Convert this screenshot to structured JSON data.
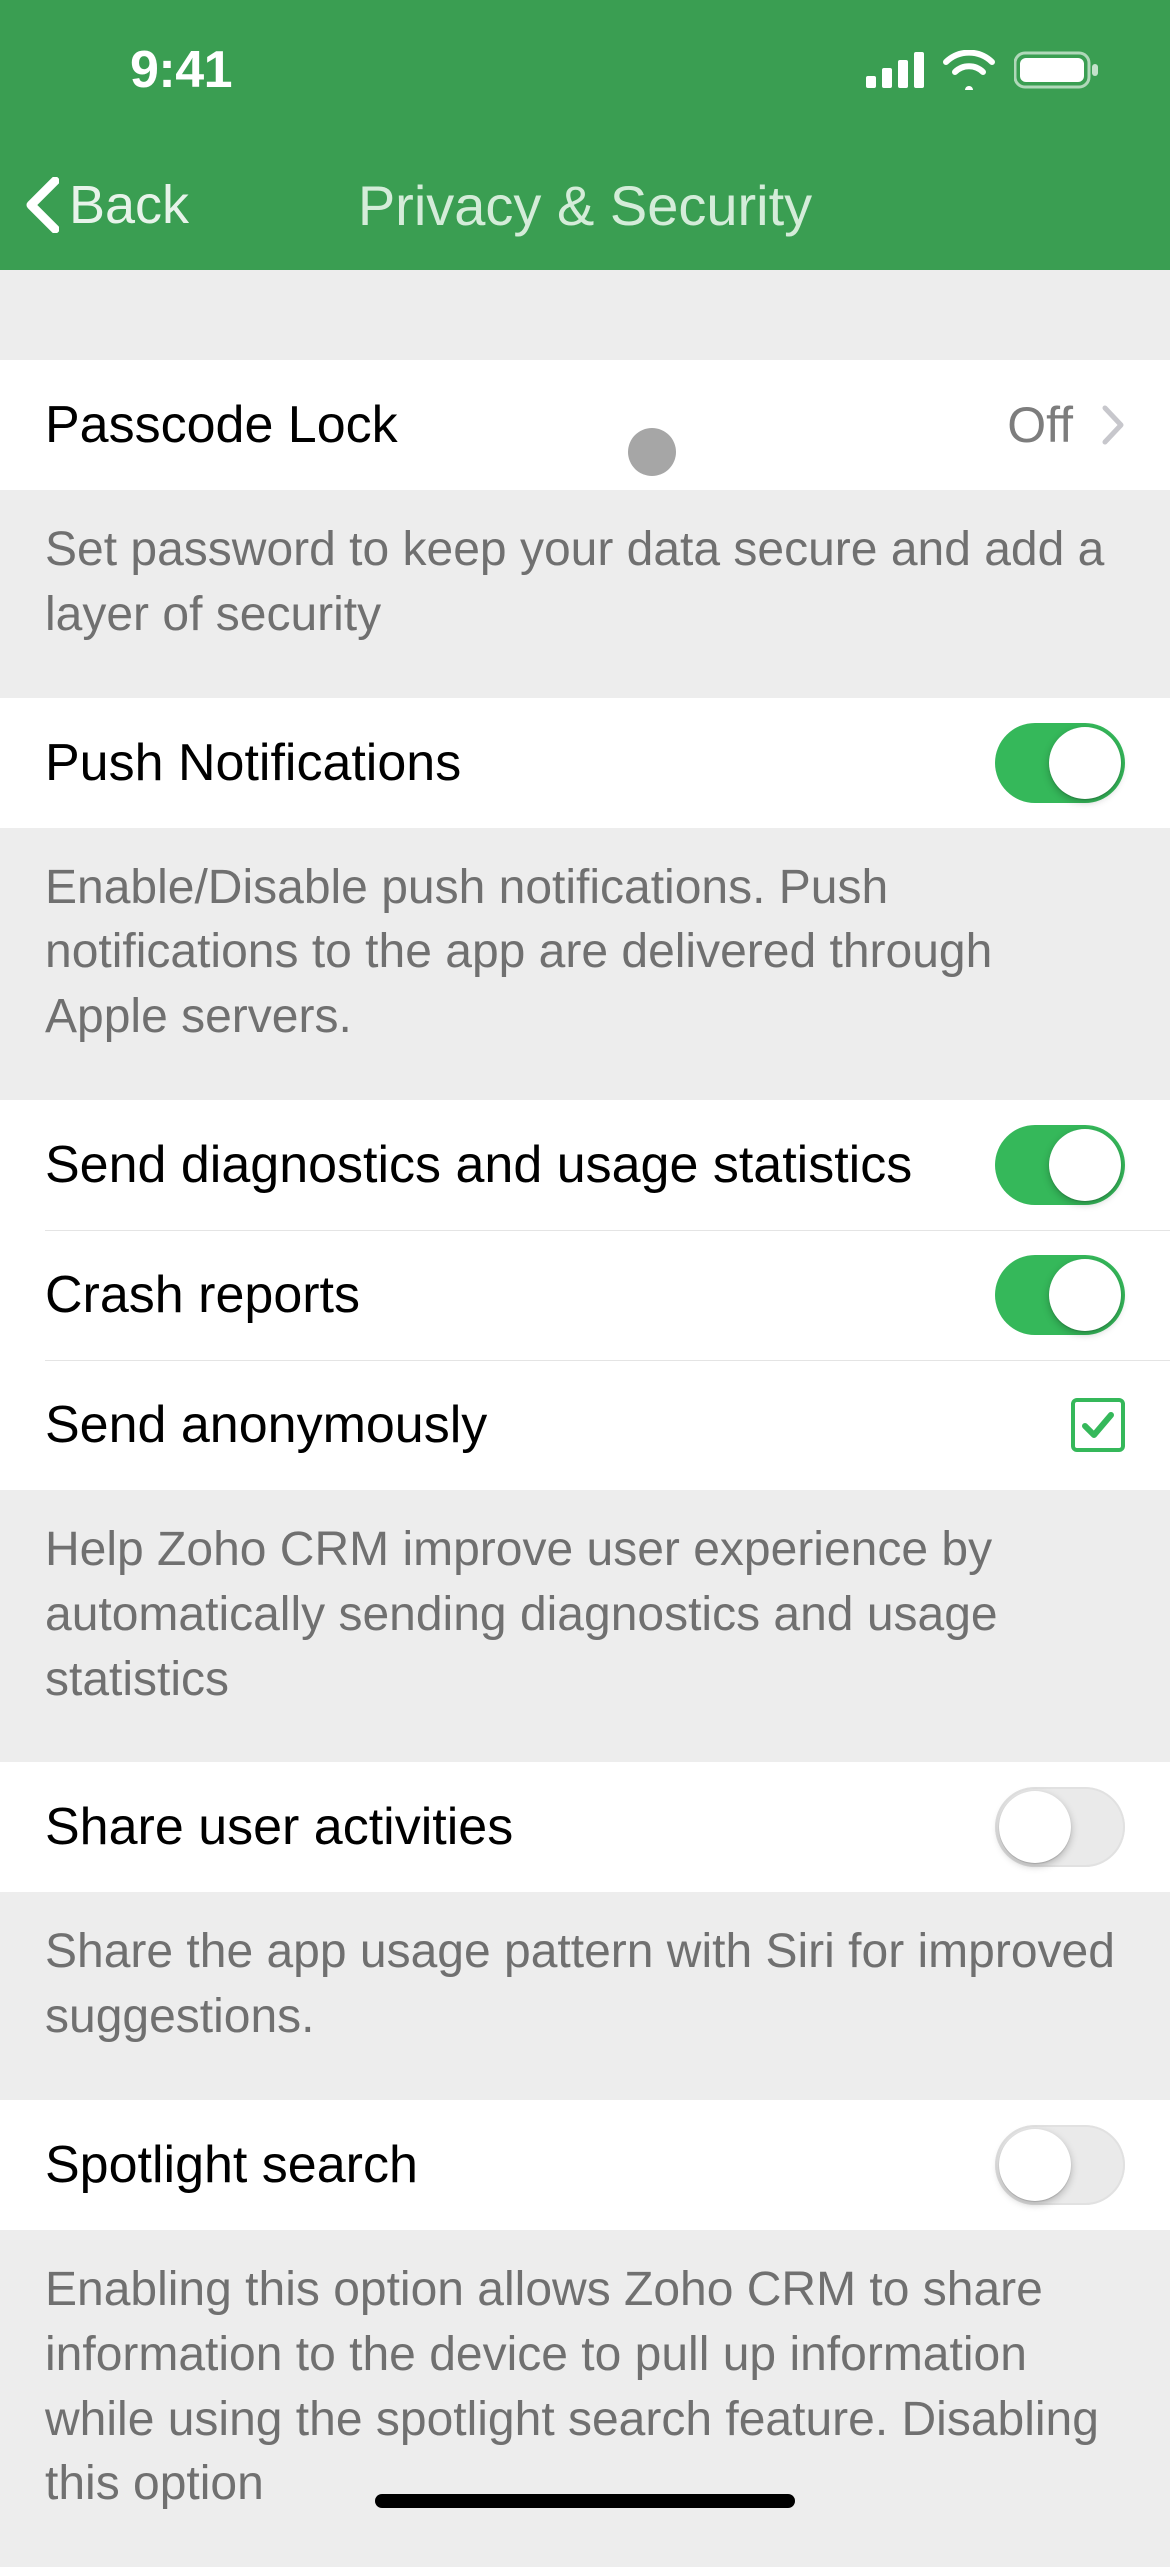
{
  "status": {
    "time": "9:41"
  },
  "nav": {
    "back": "Back",
    "title": "Privacy & Security"
  },
  "rows": {
    "passcode": {
      "label": "Passcode Lock",
      "value": "Off",
      "footer": "Set password to keep your data secure and add a layer of security"
    },
    "push": {
      "label": "Push Notifications",
      "on": true,
      "footer": "Enable/Disable push notifications. Push notifications to the app are delivered through Apple servers."
    },
    "diagnostics": {
      "label": "Send diagnostics and usage statistics",
      "on": true
    },
    "crash": {
      "label": "Crash reports",
      "on": true
    },
    "anon": {
      "label": "Send anonymously",
      "checked": true
    },
    "diag_footer": "Help Zoho CRM improve user experience by automatically sending diagnostics and usage statistics",
    "share": {
      "label": "Share user activities",
      "on": false,
      "footer": "Share the app usage pattern with Siri for improved suggestions."
    },
    "spotlight": {
      "label": "Spotlight search",
      "on": false,
      "footer": "Enabling this option allows Zoho CRM to share information to the device to pull up information while using the spotlight search feature. Disabling this option"
    }
  }
}
